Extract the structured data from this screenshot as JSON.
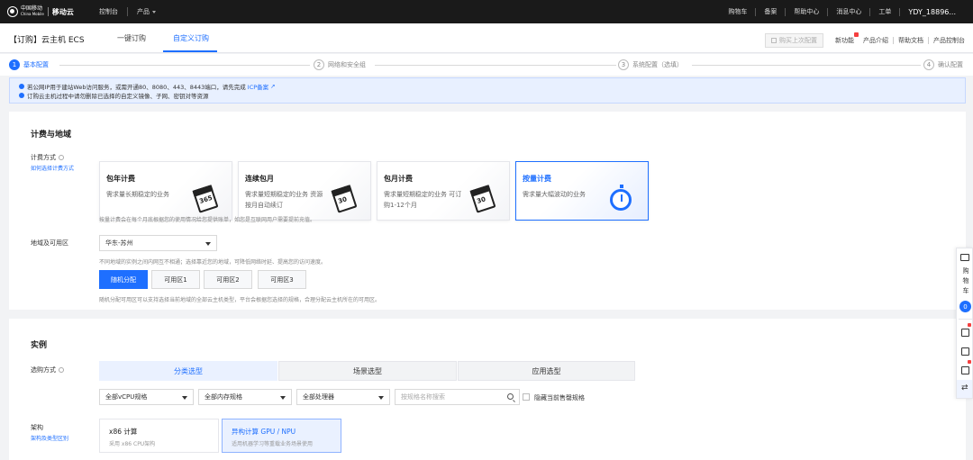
{
  "topnav": {
    "logo_cn": "中国移动",
    "logo_en": "China Mobile",
    "brand": "移动云",
    "console": "控制台",
    "products": "产品",
    "right": [
      "购物车",
      "备案",
      "帮助中心",
      "消息中心",
      "工单"
    ],
    "user": "YDY_18896..."
  },
  "titlebar": {
    "title": "【订购】云主机 ECS",
    "tabs": [
      "一键订购",
      "自定义订购"
    ],
    "buy_last": "购买上次配置",
    "links": [
      "新功能",
      "产品介绍",
      "帮助文档",
      "产品控制台"
    ]
  },
  "steps": [
    {
      "num": "1",
      "label": "基本配置"
    },
    {
      "num": "2",
      "label": "网络和安全组"
    },
    {
      "num": "3",
      "label": "系统配置（选填）"
    },
    {
      "num": "4",
      "label": "确认配置"
    }
  ],
  "notice": {
    "line1": "若公网IP用于建站Web访问服务，或需开通80、8080、443、8443端口，请先完成",
    "line1_link": "ICP备案",
    "line2": "订购云主机过程中请勿删除已选择的自定义镜像、子网、密钥对等资源"
  },
  "billing": {
    "section_title": "计费与地域",
    "label": "计费方式",
    "sub_link": "如何选择计费方式",
    "options": [
      {
        "title": "包年计费",
        "desc": "需求量长期稳定的业务",
        "icon_num": "365"
      },
      {
        "title": "连续包月",
        "desc": "需求量短期稳定的业务 资源按月自动续订",
        "icon_num": "30"
      },
      {
        "title": "包月计费",
        "desc": "需求量短期稳定的业务 可订购1-12个月",
        "icon_num": "30"
      },
      {
        "title": "按量计费",
        "desc": "需求量大幅波动的业务",
        "icon_num": ""
      }
    ],
    "hint": "按量计费会在每个月底根据您的使用情况给您提供账单，如您是互联网用户需要提前充值。"
  },
  "region": {
    "label": "地域及可用区",
    "value": "华东-苏州",
    "hint1": "不同地域的实例之间内网互不相通；选择靠近您的地域，可降低网络时延、提高您的访问速度。",
    "zones": [
      "随机分配",
      "可用区1",
      "可用区2",
      "可用区3"
    ],
    "hint2": "随机分配可用区可以支持选择当前地域的全部云主机类型，平台会根据您选择的规格，合理分配云主机所在的可用区。"
  },
  "instance": {
    "section_title": "实例",
    "label": "选购方式",
    "tabs": [
      "分类选型",
      "场景选型",
      "应用选型"
    ],
    "filters": [
      "全部vCPU规格",
      "全部内存规格",
      "全部处理器"
    ],
    "search_placeholder": "按规格名称搜索",
    "hide_sold_out": "隐藏当前售罄规格",
    "arch_label": "架构",
    "arch_link": "架构及类型区别",
    "arch_options": [
      {
        "title": "x86 计算",
        "desc": "采用 x86 CPU架构"
      },
      {
        "title": "异构计算 GPU / NPU",
        "desc": "适用机器学习等重载业务场景使用"
      }
    ]
  },
  "floatbar": {
    "cart": "购物车",
    "count": "0"
  },
  "colors": {
    "accent": "#1e6fff",
    "nav_bg": "#1a1a1a",
    "badge": "#f53f3f"
  }
}
